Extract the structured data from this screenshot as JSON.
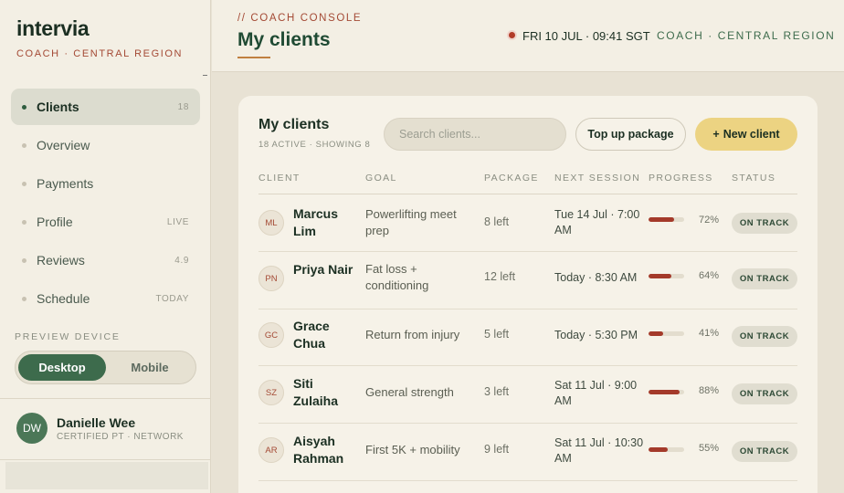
{
  "brand": {
    "name": "intervia",
    "subtitle": "COACH · CENTRAL REGION"
  },
  "sidebar": {
    "items": [
      {
        "label": "Clients",
        "meta": "18",
        "active": true
      },
      {
        "label": "Overview",
        "meta": ""
      },
      {
        "label": "Payments",
        "meta": ""
      },
      {
        "label": "Profile",
        "meta": "LIVE"
      },
      {
        "label": "Reviews",
        "meta": "4.9"
      },
      {
        "label": "Schedule",
        "meta": "TODAY"
      }
    ],
    "preview_label": "PREVIEW DEVICE",
    "preview_options": {
      "desktop": "Desktop",
      "mobile": "Mobile",
      "selected": "Desktop"
    },
    "user": {
      "initials": "DW",
      "name": "Danielle Wee",
      "role": "CERTIFIED PT · NETWORK"
    }
  },
  "header": {
    "eyebrow": "// COACH CONSOLE",
    "title": "My clients",
    "datetime": "FRI 10 JUL · 09:41 SGT",
    "region": "COACH · CENTRAL REGION"
  },
  "card": {
    "title": "My clients",
    "subtitle": "18 ACTIVE · SHOWING 8",
    "search_placeholder": "Search clients...",
    "topup_label": "Top up package",
    "new_client_label": "New client",
    "columns": [
      "CLIENT",
      "GOAL",
      "PACKAGE",
      "NEXT SESSION",
      "PROGRESS",
      "STATUS"
    ],
    "rows": [
      {
        "initials": "ML",
        "name": "Marcus Lim",
        "goal": "Powerlifting meet prep",
        "package": "8 left",
        "next": "Tue 14 Jul · 7:00 AM",
        "progress": 72,
        "pct": "72%",
        "status": "ON TRACK"
      },
      {
        "initials": "PN",
        "name": "Priya Nair",
        "goal": "Fat loss + conditioning",
        "package": "12 left",
        "next": "Today · 8:30 AM",
        "progress": 64,
        "pct": "64%",
        "status": "ON TRACK"
      },
      {
        "initials": "GC",
        "name": "Grace Chua",
        "goal": "Return from injury",
        "package": "5 left",
        "next": "Today · 5:30 PM",
        "progress": 41,
        "pct": "41%",
        "status": "ON TRACK"
      },
      {
        "initials": "SZ",
        "name": "Siti Zulaiha",
        "goal": "General strength",
        "package": "3 left",
        "next": "Sat 11 Jul · 9:00 AM",
        "progress": 88,
        "pct": "88%",
        "status": "ON TRACK"
      },
      {
        "initials": "AR",
        "name": "Aisyah Rahman",
        "goal": "First 5K + mobility",
        "package": "9 left",
        "next": "Sat 11 Jul · 10:30 AM",
        "progress": 55,
        "pct": "55%",
        "status": "ON TRACK"
      }
    ]
  },
  "colors": {
    "accent": "#a44a35",
    "brand_green": "#3d6b4c",
    "cta": "#ecd382"
  },
  "icons": {
    "nav_bullet": "dot-icon",
    "live_indicator": "live-dot-icon",
    "new_client": "plus-icon"
  }
}
